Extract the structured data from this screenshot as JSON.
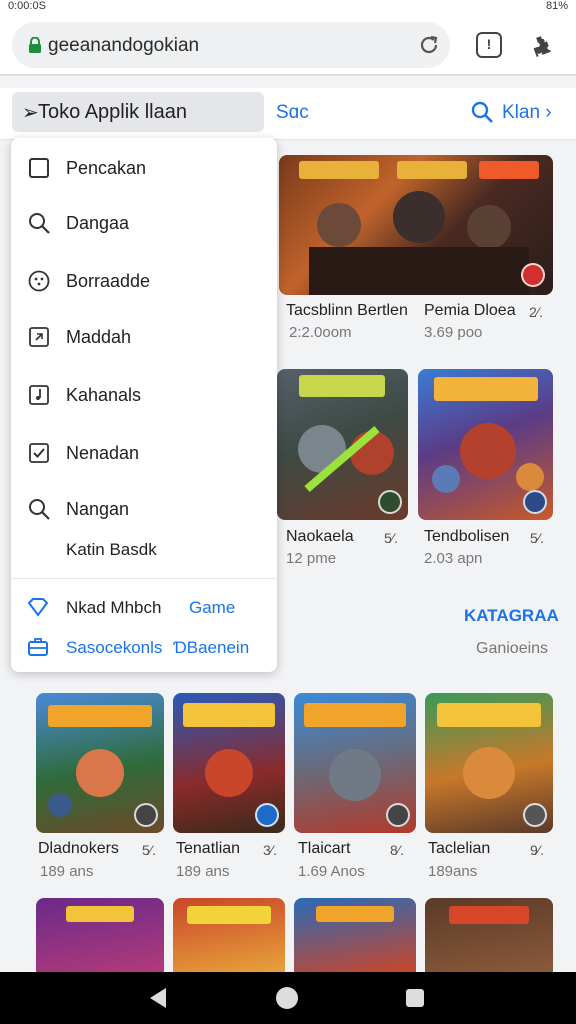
{
  "status_bar": {
    "left": "0:00:0S",
    "right": "81%"
  },
  "browser": {
    "url": "geeanandogokian",
    "tabs_count": "!"
  },
  "header": {
    "store_label": "Toko Applik llaan",
    "tab_label": "Sɑc",
    "right_label": "Klan ›"
  },
  "menu": {
    "items": [
      {
        "label": "Pencakan",
        "icon": "checkbox-empty-icon"
      },
      {
        "label": "Dangaa",
        "icon": "search-icon"
      },
      {
        "label": "Borraadde",
        "icon": "settings-circle-icon"
      },
      {
        "label": "Maddah",
        "icon": "square-arrow-icon"
      },
      {
        "label": "Kahanals",
        "icon": "square-music-icon"
      },
      {
        "label": "Nenadan",
        "icon": "checkbox-checked-icon"
      },
      {
        "label": "Nangan",
        "icon": "search-icon"
      }
    ],
    "sub_label": "Katin Basdk",
    "footer_1": {
      "label": "Nkad Mhbch",
      "tag": "Game"
    },
    "footer_2": {
      "label": "Sasocekonls",
      "tag": "ƊBaenein"
    }
  },
  "featured": [
    {
      "title": "Tacsblinn Bertlen",
      "meta": "2:2.0oom"
    },
    {
      "title": "Pemia Dloea",
      "meta": "3.69 poo",
      "rating": "2⁄."
    },
    {
      "title": "Naokaela",
      "meta": "12 pme",
      "rating": "5⁄."
    },
    {
      "title": "Tendbolisen",
      "meta": "2.03 apn",
      "rating": "5⁄."
    }
  ],
  "section": {
    "title": "KATAGRAA",
    "subtitle": "Ganioeins"
  },
  "grid": [
    {
      "title": "Dladnokers",
      "meta": "189 ans",
      "rating": "5⁄."
    },
    {
      "title": "Tenatlian",
      "meta": "189 ans",
      "rating": "3⁄."
    },
    {
      "title": "Tlaicart",
      "meta": "1.69 Anos",
      "rating": "8⁄."
    },
    {
      "title": "Taclelian",
      "meta": "189ans",
      "rating": "9⁄."
    }
  ],
  "colors": {
    "accent": "#1a73e8",
    "lock": "#1e8e3e"
  }
}
